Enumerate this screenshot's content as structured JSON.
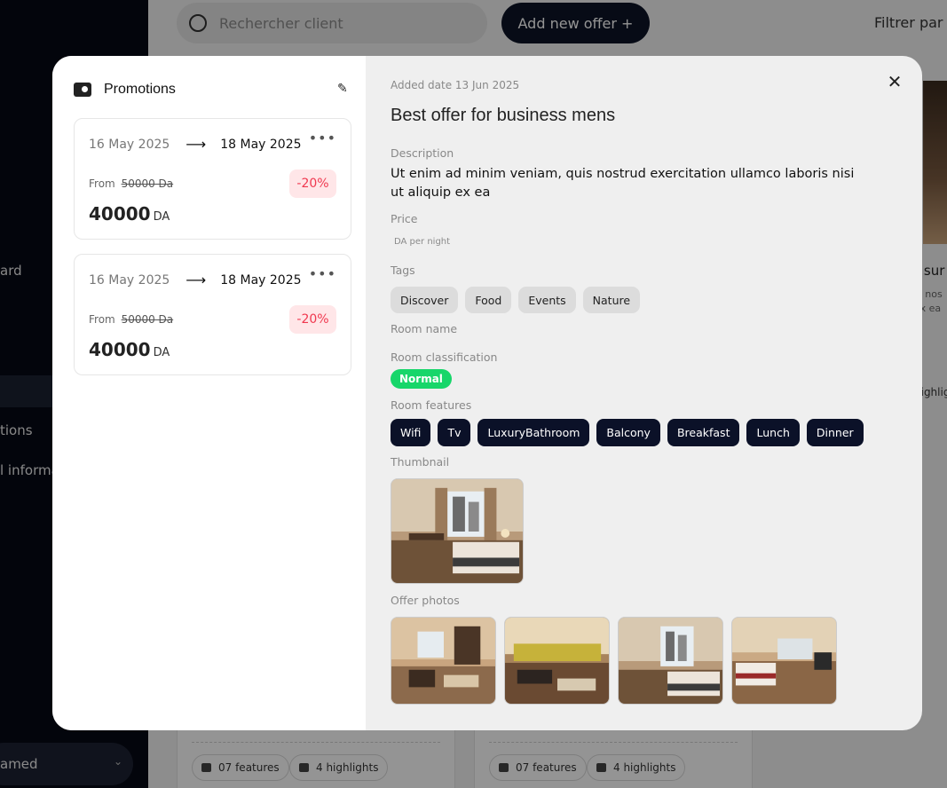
{
  "background": {
    "search_placeholder": "Rechercher client",
    "add_offer_label": "Add new offer +",
    "filter_label": "Filtrer par",
    "sidebar_items": [
      "ard",
      "tions",
      "l informa"
    ],
    "profile_name": "amed",
    "card_pills": [
      {
        "features": "07 features",
        "highlights": "4 highlights"
      },
      {
        "features": "07 features",
        "highlights": "4 highlights"
      }
    ],
    "right_texts": [
      "r sur",
      "is nos",
      "ex ea",
      "highlig"
    ]
  },
  "promotions": {
    "title": "Promotions",
    "items": [
      {
        "date_from": "16 May 2025",
        "date_to": "18 May 2025",
        "from_label": "From",
        "old_price": "50000 Da",
        "discount": "-20%",
        "price": "40000",
        "currency": "DA"
      },
      {
        "date_from": "16 May 2025",
        "date_to": "18 May 2025",
        "from_label": "From",
        "old_price": "50000 Da",
        "discount": "-20%",
        "price": "40000",
        "currency": "DA"
      }
    ]
  },
  "offer": {
    "added_date": "Added date 13 Jun 2025",
    "title": "Best offer for business mens",
    "description_label": "Description",
    "description": "Ut enim ad minim veniam, quis nostrud exercitation ullamco laboris nisi ut aliquip ex ea",
    "price_label": "Price",
    "price_note": "DA per night",
    "tags_label": "Tags",
    "tags": [
      "Discover",
      "Food",
      "Events",
      "Nature"
    ],
    "room_name_label": "Room name",
    "room_classification_label": "Room classification",
    "room_classification": "Normal",
    "room_features_label": "Room features",
    "room_features": [
      "Wifi",
      "Tv",
      "LuxuryBathroom",
      "Balcony",
      "Breakfast",
      "Lunch",
      "Dinner"
    ],
    "thumbnail_label": "Thumbnail",
    "offer_photos_label": "Offer photos"
  },
  "colors": {
    "accent_dark": "#0b1128",
    "classification_green": "#17d66a",
    "discount_red": "#f0384f"
  }
}
